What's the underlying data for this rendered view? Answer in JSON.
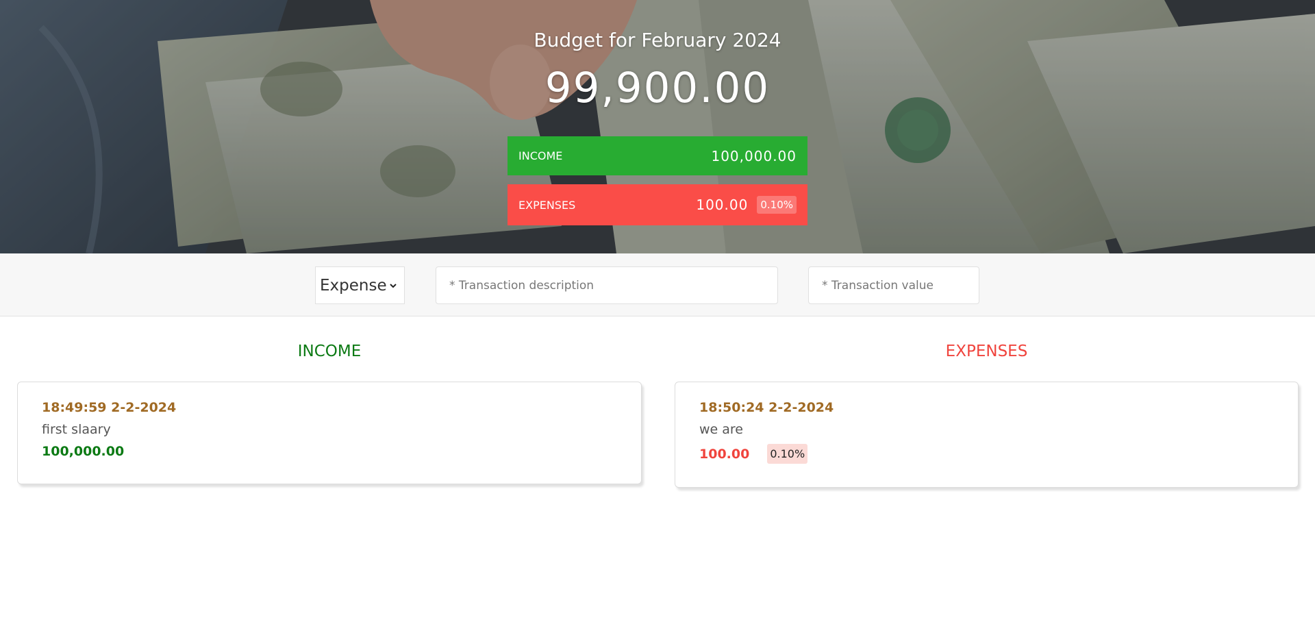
{
  "header": {
    "title": "Budget for February 2024",
    "total": "99,900.00"
  },
  "summary": {
    "income": {
      "label": "INCOME",
      "value": "100,000.00",
      "color": "#28ac32"
    },
    "expenses": {
      "label": "EXPENSES",
      "value": "100.00",
      "percent": "0.10%",
      "color": "#fa4d48"
    }
  },
  "add_form": {
    "type_selected": "Expense",
    "description_placeholder": "* Transaction description",
    "value_placeholder": "* Transaction value"
  },
  "income_list": {
    "title": "INCOME",
    "items": [
      {
        "time": "18:49:59 2-2-2024",
        "description": "first slaary",
        "amount": "100,000.00"
      }
    ]
  },
  "expenses_list": {
    "title": "EXPENSES",
    "items": [
      {
        "time": "18:50:24 2-2-2024",
        "description": "we are",
        "amount": "100.00",
        "percent": "0.10%"
      }
    ]
  }
}
